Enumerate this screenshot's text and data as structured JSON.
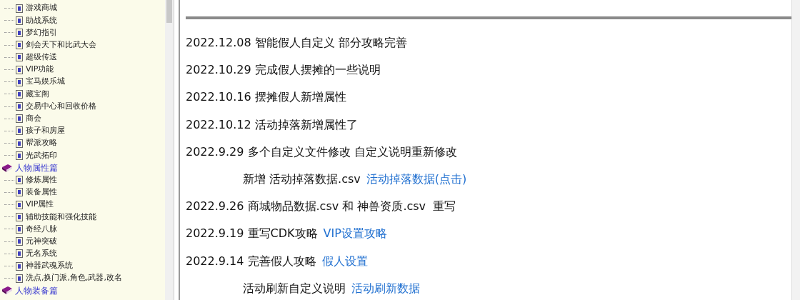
{
  "sidebar": {
    "continued_items": [
      {
        "label": "游戏商城"
      },
      {
        "label": "助战系统"
      },
      {
        "label": "梦幻指引"
      },
      {
        "label": "剑会天下和比武大会"
      },
      {
        "label": "超级传送"
      },
      {
        "label": "VIP功能"
      },
      {
        "label": "宝马娱乐城"
      },
      {
        "label": "藏宝阁"
      },
      {
        "label": "交易中心和回收价格"
      },
      {
        "label": "商会"
      },
      {
        "label": "孩子和房屋"
      },
      {
        "label": "帮派攻略"
      },
      {
        "label": "光武拓印"
      }
    ],
    "books": [
      {
        "label": "人物属性篇",
        "children": [
          {
            "label": "修炼属性"
          },
          {
            "label": "装备属性"
          },
          {
            "label": "VIP属性"
          },
          {
            "label": "辅助技能和强化技能"
          },
          {
            "label": "奇经八脉"
          },
          {
            "label": "元神突破"
          },
          {
            "label": "无名系统"
          },
          {
            "label": "神器武魂系统"
          },
          {
            "label": "洗点,换门派,角色,武器,改名"
          }
        ]
      },
      {
        "label": "人物装备篇"
      }
    ]
  },
  "changelog": [
    {
      "kind": "entry",
      "parts": [
        {
          "kind": "text",
          "text": "2022.12.08 智能假人自定义 部分攻略完善"
        }
      ]
    },
    {
      "kind": "entry",
      "parts": [
        {
          "kind": "text",
          "text": "2022.10.29 完成假人摆摊的一些说明"
        }
      ]
    },
    {
      "kind": "entry",
      "parts": [
        {
          "kind": "text",
          "text": "2022.10.16 摆摊假人新增属性"
        }
      ]
    },
    {
      "kind": "entry",
      "parts": [
        {
          "kind": "text",
          "text": "2022.10.12 活动掉落新增属性了"
        }
      ]
    },
    {
      "kind": "entry",
      "parts": [
        {
          "kind": "text",
          "text": "2022.9.29 多个自定义文件修改 自定义说明重新修改"
        }
      ]
    },
    {
      "kind": "sub",
      "parts": [
        {
          "kind": "text",
          "text": "新增 活动掉落数据.csv"
        },
        {
          "kind": "link",
          "text": "活动掉落数据(点击)"
        }
      ]
    },
    {
      "kind": "entry",
      "parts": [
        {
          "kind": "text",
          "text": "2022.9.26 商城物品数据.csv 和 神兽资质.csv  重写"
        }
      ]
    },
    {
      "kind": "entry",
      "parts": [
        {
          "kind": "text",
          "text": "2022.9.19 重写CDK攻略"
        },
        {
          "kind": "link",
          "text": "VIP设置攻略"
        }
      ]
    },
    {
      "kind": "entry",
      "parts": [
        {
          "kind": "text",
          "text": "2022.9.14 完善假人攻略"
        },
        {
          "kind": "link",
          "text": "假人设置"
        }
      ]
    },
    {
      "kind": "sub",
      "parts": [
        {
          "kind": "text",
          "text": "活动刷新自定义说明"
        },
        {
          "kind": "link",
          "text": "活动刷新数据"
        }
      ]
    }
  ]
}
